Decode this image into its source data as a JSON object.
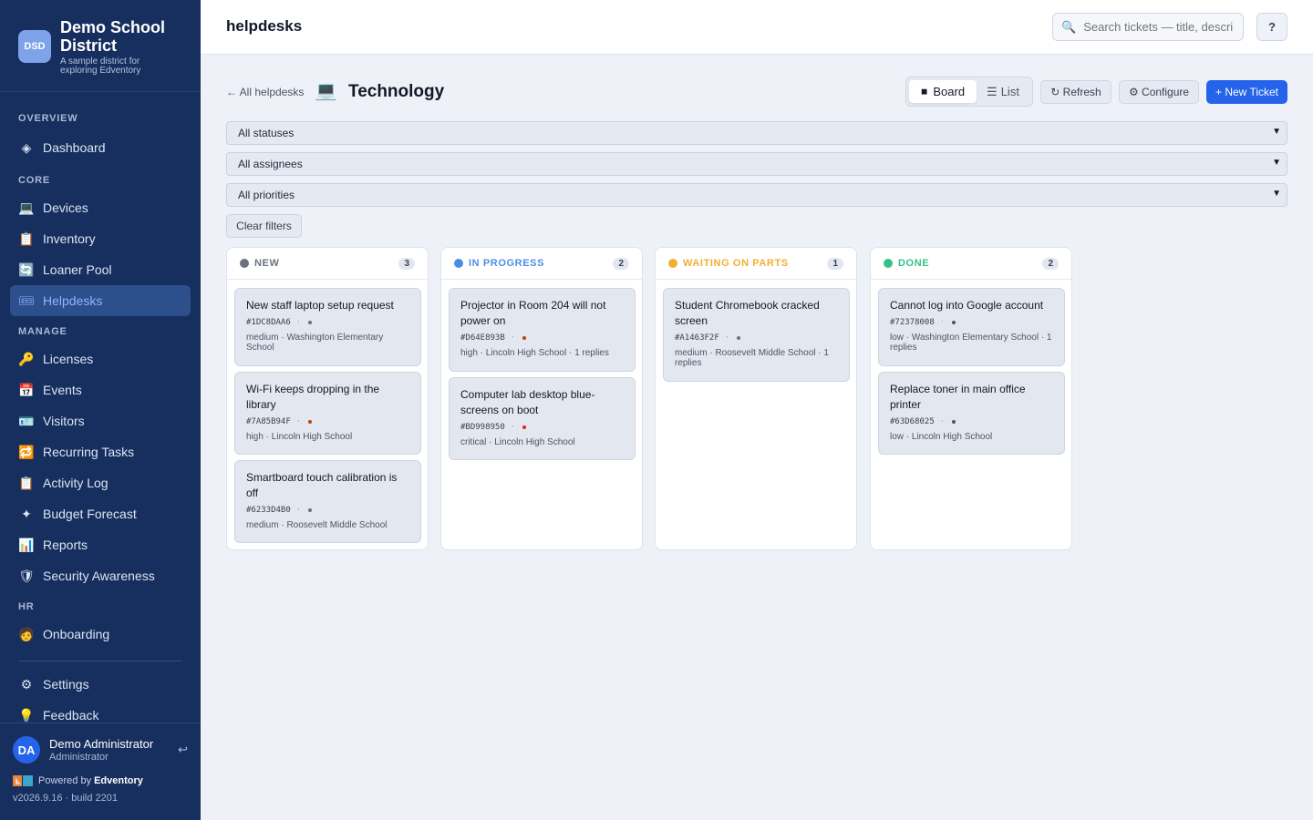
{
  "org": {
    "logo_text": "DSD",
    "name": "Demo School District",
    "tagline": "A sample district for exploring Edventory"
  },
  "sidebar": {
    "sections": [
      {
        "label": "OVERVIEW",
        "items": [
          {
            "label": "Dashboard",
            "icon": "diamond-icon"
          }
        ]
      },
      {
        "label": "CORE",
        "items": [
          {
            "label": "Devices",
            "icon": "laptop-icon"
          },
          {
            "label": "Inventory",
            "icon": "clipboard-icon"
          },
          {
            "label": "Loaner Pool",
            "icon": "cycle-icon"
          },
          {
            "label": "Helpdesks",
            "icon": "ticket-icon",
            "active": true
          }
        ]
      },
      {
        "label": "MANAGE",
        "items": [
          {
            "label": "Licenses",
            "icon": "key-icon"
          },
          {
            "label": "Events",
            "icon": "calendar-icon"
          },
          {
            "label": "Visitors",
            "icon": "id-card-icon"
          },
          {
            "label": "Recurring Tasks",
            "icon": "repeat-icon"
          },
          {
            "label": "Activity Log",
            "icon": "clipboard-icon"
          },
          {
            "label": "Budget Forecast",
            "icon": "sparkle-icon"
          },
          {
            "label": "Reports",
            "icon": "bar-chart-icon"
          },
          {
            "label": "Security Awareness",
            "icon": "shield-icon"
          }
        ]
      },
      {
        "label": "HR",
        "items": [
          {
            "label": "Onboarding",
            "icon": "person-icon"
          }
        ]
      }
    ],
    "settings_label": "Settings",
    "feedback_label": "Feedback"
  },
  "user": {
    "initials": "DA",
    "name": "Demo Administrator",
    "role": "Administrator",
    "powered_by": "Powered by",
    "product": "Edventory",
    "version": "v2026.9.16 · build 2201"
  },
  "topbar": {
    "title": "helpdesks",
    "search_placeholder": "Search tickets — title, description",
    "help_label": "?"
  },
  "helpdesk": {
    "back_label": "← All helpdesks",
    "icon": "💻",
    "title": "Technology",
    "view_board": "Board",
    "view_list": "List",
    "refresh": "↻ Refresh",
    "configure": "⚙ Configure",
    "new_ticket": "+ New Ticket"
  },
  "filters": {
    "status": "All statuses",
    "assignee": "All assignees",
    "priority": "All priorities",
    "clear": "Clear filters"
  },
  "board": {
    "columns": [
      {
        "title": "NEW",
        "count": "3",
        "color": "#6b7280",
        "cards": [
          {
            "title": "New staff laptop setup request",
            "id": "#1DC8DAA6",
            "priority_color": "#6b7280",
            "meta": "medium · Washington Elementary School"
          },
          {
            "title": "Wi-Fi keeps dropping in the library",
            "id": "#7A85B94F",
            "priority_color": "#c2410c",
            "meta": "high · Lincoln High School"
          },
          {
            "title": "Smartboard touch calibration is off",
            "id": "#6233D4B0",
            "priority_color": "#6b7280",
            "meta": "medium · Roosevelt Middle School"
          }
        ]
      },
      {
        "title": "IN PROGRESS",
        "count": "2",
        "color": "#4a90e2",
        "cards": [
          {
            "title": "Projector in Room 204 will not power on",
            "id": "#D64E893B",
            "priority_color": "#c2410c",
            "meta": "high · Lincoln High School · 1 replies"
          },
          {
            "title": "Computer lab desktop blue-screens on boot",
            "id": "#BD998950",
            "priority_color": "#dc2626",
            "meta": "critical · Lincoln High School"
          }
        ]
      },
      {
        "title": "WAITING ON PARTS",
        "count": "1",
        "color": "#f0b030",
        "cards": [
          {
            "title": "Student Chromebook cracked screen",
            "id": "#A1463F2F",
            "priority_color": "#6b7280",
            "meta": "medium · Roosevelt Middle School · 1 replies"
          }
        ]
      },
      {
        "title": "DONE",
        "count": "2",
        "color": "#34c28a",
        "cards": [
          {
            "title": "Cannot log into Google account",
            "id": "#72378008",
            "priority_color": "#4b5563",
            "meta": "low · Washington Elementary School · 1 replies"
          },
          {
            "title": "Replace toner in main office printer",
            "id": "#63D68025",
            "priority_color": "#4b5563",
            "meta": "low · Lincoln High School"
          }
        ]
      }
    ]
  }
}
